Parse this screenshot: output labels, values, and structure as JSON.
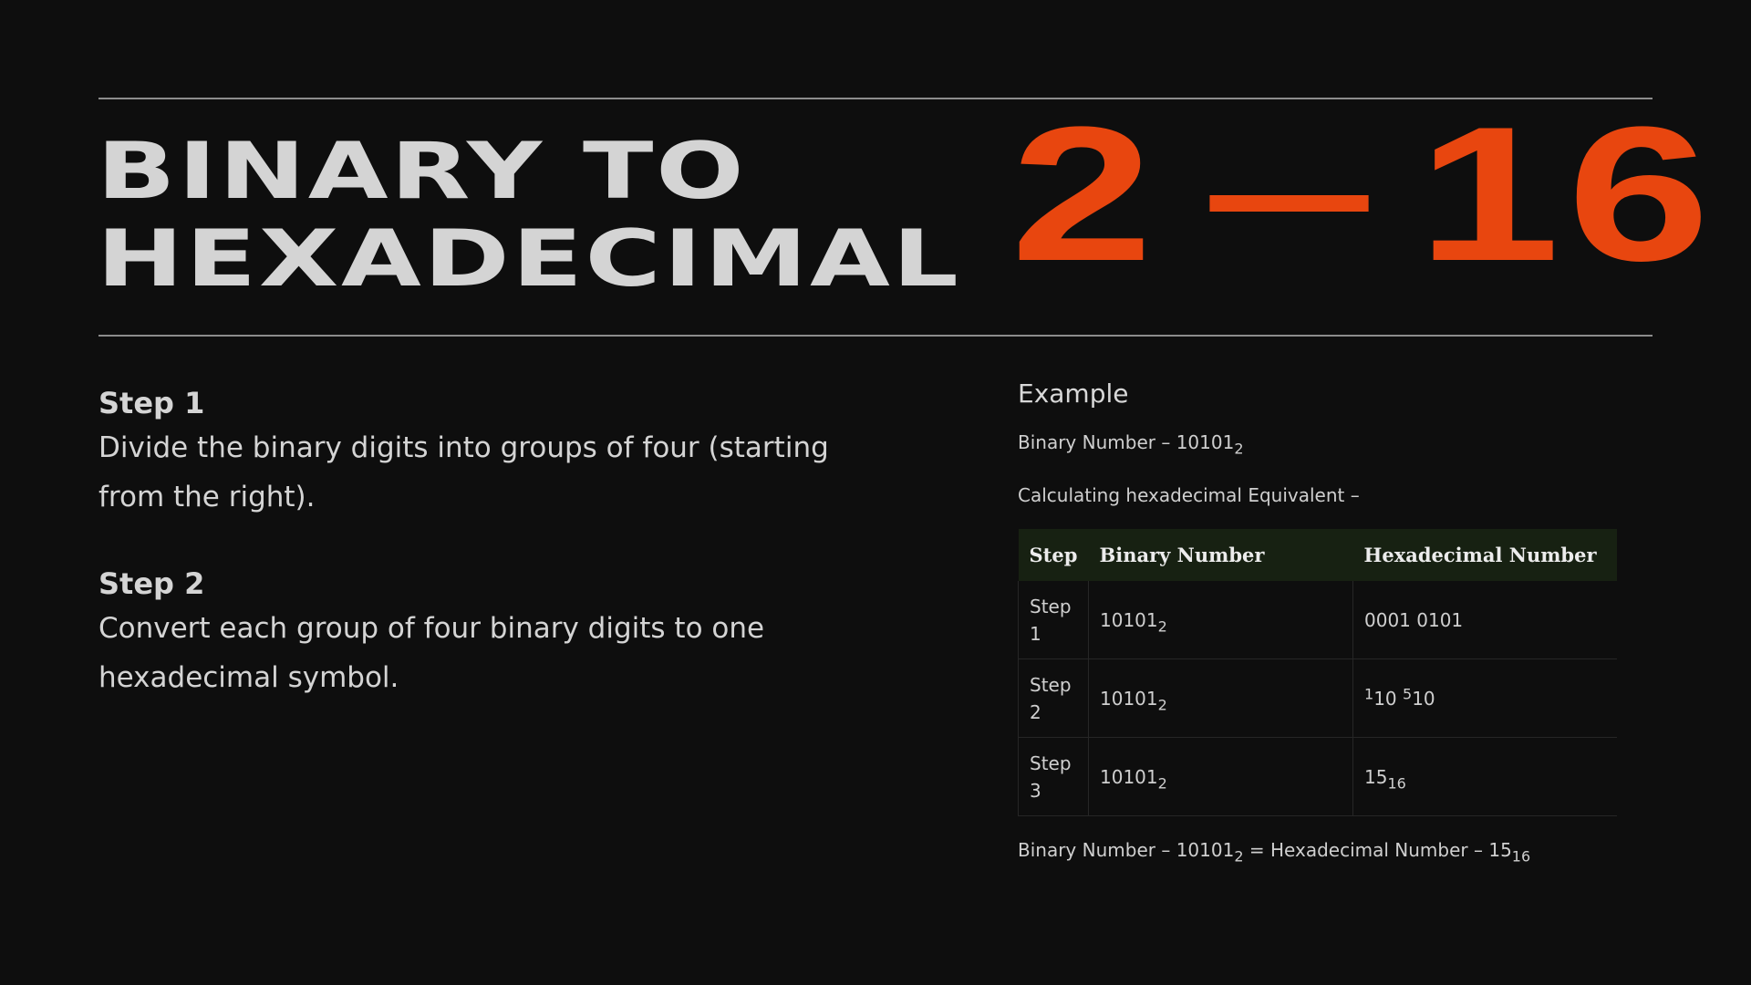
{
  "title": {
    "line1": "BINARY TO",
    "line2": "HEXADECIMAL"
  },
  "big_number": {
    "from": "2",
    "to": "16"
  },
  "steps": [
    {
      "title": "Step 1",
      "text": "Divide the binary digits into groups of four (starting from the right)."
    },
    {
      "title": "Step 2",
      "text": "Convert each group of four binary digits to one hexadecimal symbol."
    }
  ],
  "example": {
    "heading": "Example",
    "binary_label": "Binary Number – ",
    "binary_value": "10101",
    "binary_base": "2",
    "calc_label": "Calculating hexadecimal Equivalent –",
    "table": {
      "headers": [
        "Step",
        "Binary Number",
        "Hexadecimal Number"
      ],
      "rows": [
        {
          "step_word": "Step",
          "step_num": "1",
          "binary": "10101",
          "binary_base": "2",
          "hex": "0001 0101"
        },
        {
          "step_word": "Step",
          "step_num": "2",
          "binary": "10101",
          "binary_base": "2",
          "hex_a": "1",
          "hex_a_base": "10",
          "hex_b": "5",
          "hex_b_base": "10"
        },
        {
          "step_word": "Step",
          "step_num": "3",
          "binary": "10101",
          "binary_base": "2",
          "hex": "15",
          "hex_base": "16"
        }
      ]
    },
    "result": {
      "left_label": "Binary Number – ",
      "left_value": "10101",
      "left_base": "2",
      "equals": " = ",
      "right_label": "Hexadecimal Number – ",
      "right_value": "15",
      "right_base": "16"
    }
  }
}
